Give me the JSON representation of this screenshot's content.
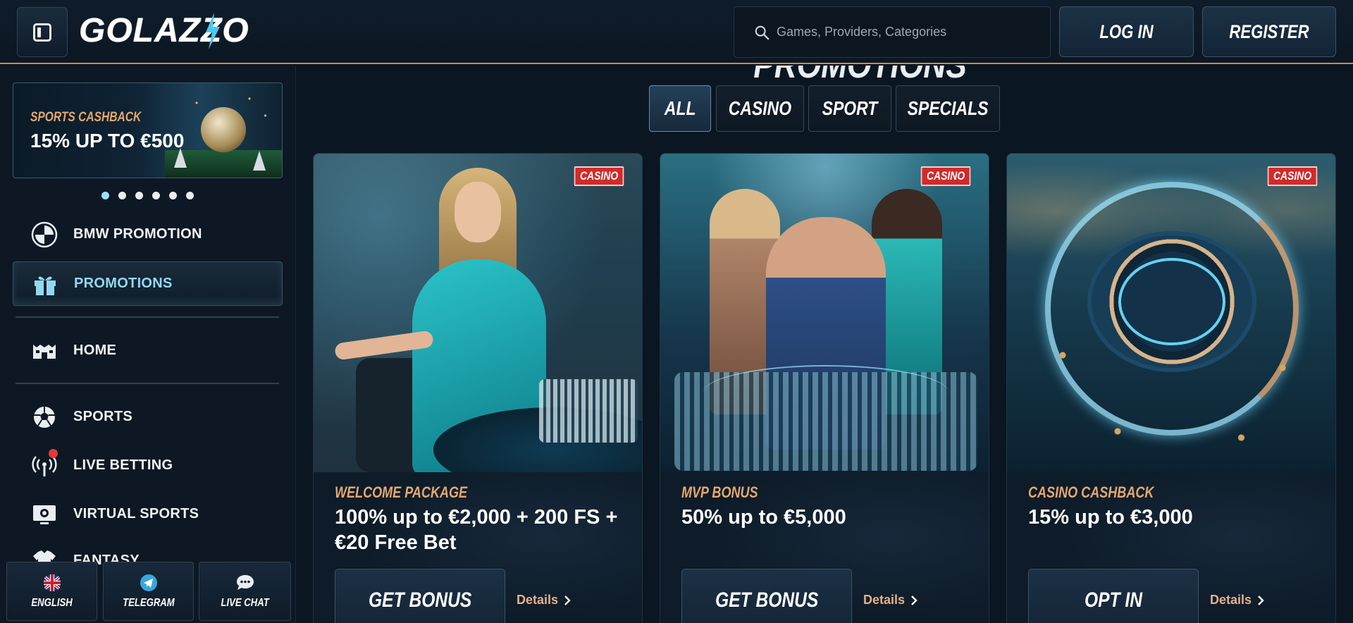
{
  "header": {
    "logo_text": "GOLAZZO",
    "search_placeholder": "Games, Providers, Categories",
    "login_label": "LOG IN",
    "register_label": "REGISTER"
  },
  "sidebar": {
    "banner": {
      "subtitle": "SPORTS CASHBACK",
      "title": "15% UP TO €500",
      "slides_count": 6,
      "active_slide": 1
    },
    "items": [
      {
        "label": "BMW PROMOTION",
        "icon": "bmw-icon"
      },
      {
        "label": "PROMOTIONS",
        "icon": "gift-icon",
        "active": true
      },
      {
        "label": "HOME",
        "icon": "stadium-icon"
      },
      {
        "label": "SPORTS",
        "icon": "soccer-ball-icon"
      },
      {
        "label": "LIVE BETTING",
        "icon": "broadcast-icon"
      },
      {
        "label": "VIRTUAL SPORTS",
        "icon": "monitor-soccer-icon"
      },
      {
        "label": "FANTASY",
        "icon": "jersey-icon"
      }
    ],
    "footer": [
      {
        "label": "ENGLISH",
        "icon": "uk-flag-icon"
      },
      {
        "label": "TELEGRAM",
        "icon": "telegram-icon"
      },
      {
        "label": "LIVE CHAT",
        "icon": "chat-icon"
      }
    ]
  },
  "main": {
    "title": "PROMOTIONS",
    "tabs": [
      {
        "label": "ALL",
        "active": true
      },
      {
        "label": "CASINO"
      },
      {
        "label": "SPORT"
      },
      {
        "label": "SPECIALS"
      }
    ],
    "cards": [
      {
        "badge": "CASINO",
        "subtitle": "WELCOME PACKAGE",
        "title": "100% up to €2,000 + 200 FS + €20 Free Bet",
        "cta": "GET BONUS",
        "details": "Details"
      },
      {
        "badge": "CASINO",
        "subtitle": "MVP BONUS",
        "title": "50% up to €5,000",
        "cta": "GET BONUS",
        "details": "Details"
      },
      {
        "badge": "CASINO",
        "subtitle": "CASINO CASHBACK",
        "title": "15% up to €3,000",
        "cta": "OPT IN",
        "details": "Details"
      }
    ]
  },
  "colors": {
    "accent_orange": "#e3a86f",
    "active_cyan": "#8fd9f0",
    "badge_red": "#d22a2a",
    "background": "#0a1420"
  }
}
